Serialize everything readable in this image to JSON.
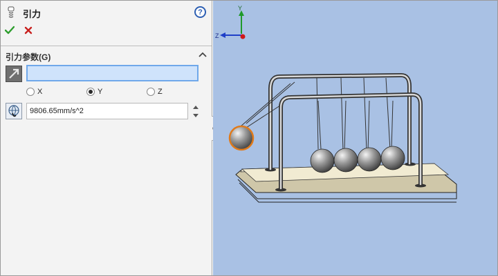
{
  "panel": {
    "title": "引力",
    "help_symbol": "?",
    "group_title": "引力参数(G)",
    "direction_field": {
      "value": ""
    },
    "axes": [
      {
        "label": "X",
        "checked": false
      },
      {
        "label": "Y",
        "checked": true
      },
      {
        "label": "Z",
        "checked": false
      }
    ],
    "gravity_value": "9806.65mm/s^2"
  },
  "icons": {
    "feature": "gravity-feature-icon",
    "ok": "checkmark-icon",
    "cancel": "x-icon",
    "help": "help-icon",
    "collapse": "chevron-up-icon",
    "direction": "direction-arrow-icon",
    "gravity": "globe-gravity-icon"
  },
  "viewport": {
    "triad": {
      "y_label": "Y",
      "z_label": "Z"
    }
  },
  "colors": {
    "viewport_bg": "#a9c1e4",
    "ok": "#2e9e2e",
    "cancel": "#c8201e",
    "selection_highlight": "#e07a1a"
  }
}
